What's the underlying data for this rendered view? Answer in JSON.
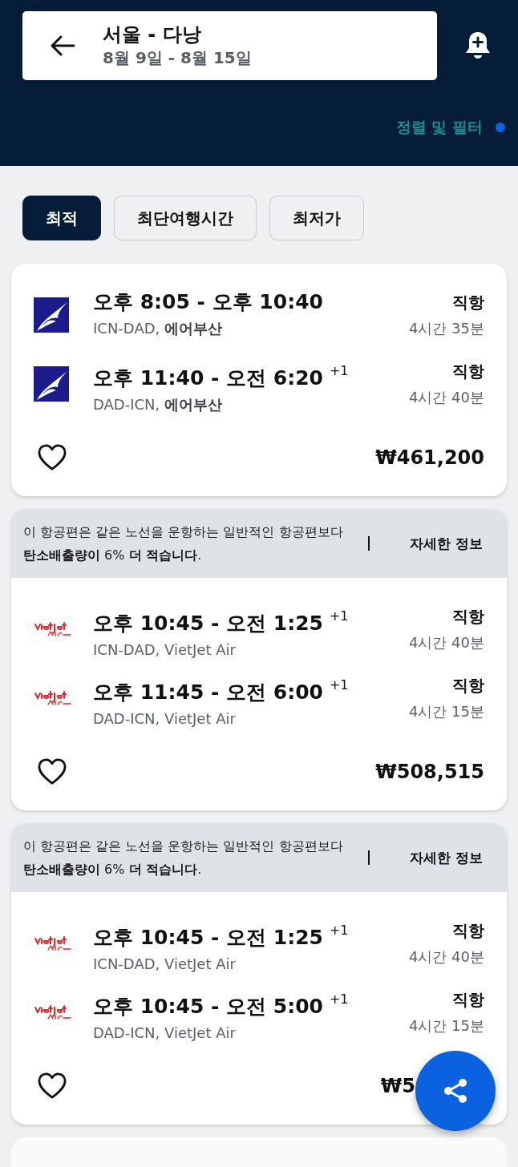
{
  "header": {
    "route": "서울 - 다낭",
    "dates": "8월 9일 - 8월 15일",
    "sort_filter": "정렬 및 필터",
    "filter_active": true
  },
  "sort_tabs": [
    {
      "label": "최적",
      "selected": true
    },
    {
      "label": "최단여행시간",
      "selected": false
    },
    {
      "label": "최저가",
      "selected": false
    }
  ],
  "results": [
    {
      "legs": [
        {
          "kind": "airbusan",
          "time": "오후 8:05 - 오후 10:40",
          "route": "ICN-DAD, **에어부산**",
          "stops": "직항",
          "duration": "4시간 35분"
        },
        {
          "kind": "airbusan",
          "time": "오후 11:40 - 오전 6:20",
          "day_offset": "+1",
          "route": "DAD-ICN, **에어부산**",
          "stops": "직항",
          "duration": "4시간 40분"
        }
      ],
      "price": "₩461,200"
    },
    {
      "banner": {
        "text": "이 항공편은 같은 노선을 운항하는 일반적인 항공편보다 **탄소배출량이** 6% **더 적습니다**.",
        "link": "자세한 정보"
      },
      "legs": [
        {
          "kind": "vietjet",
          "time": "오후 10:45 - 오전 1:25",
          "day_offset": "+1",
          "route": "ICN-DAD, VietJet Air",
          "stops": "직항",
          "duration": "4시간 40분"
        },
        {
          "kind": "vietjet",
          "time": "오후 11:45 - 오전 6:00",
          "day_offset": "+1",
          "route": "DAD-ICN, VietJet Air",
          "stops": "직항",
          "duration": "4시간 15분"
        }
      ],
      "price": "₩508,515"
    },
    {
      "banner": {
        "text": "이 항공편은 같은 노선을 운항하는 일반적인 항공편보다 **탄소배출량이** 6% **더 적습니다**.",
        "link": "자세한 정보"
      },
      "legs": [
        {
          "kind": "vietjet",
          "time": "오후 10:45 - 오전 1:25",
          "day_offset": "+1",
          "route": "ICN-DAD, VietJet Air",
          "stops": "직항",
          "duration": "4시간 40분"
        },
        {
          "kind": "vietjet",
          "time": "오후 10:45 - 오전 5:00",
          "day_offset": "+1",
          "route": "DAD-ICN, VietJet Air",
          "stops": "직항",
          "duration": "4시간 15분"
        }
      ],
      "price": "₩5"
    }
  ]
}
